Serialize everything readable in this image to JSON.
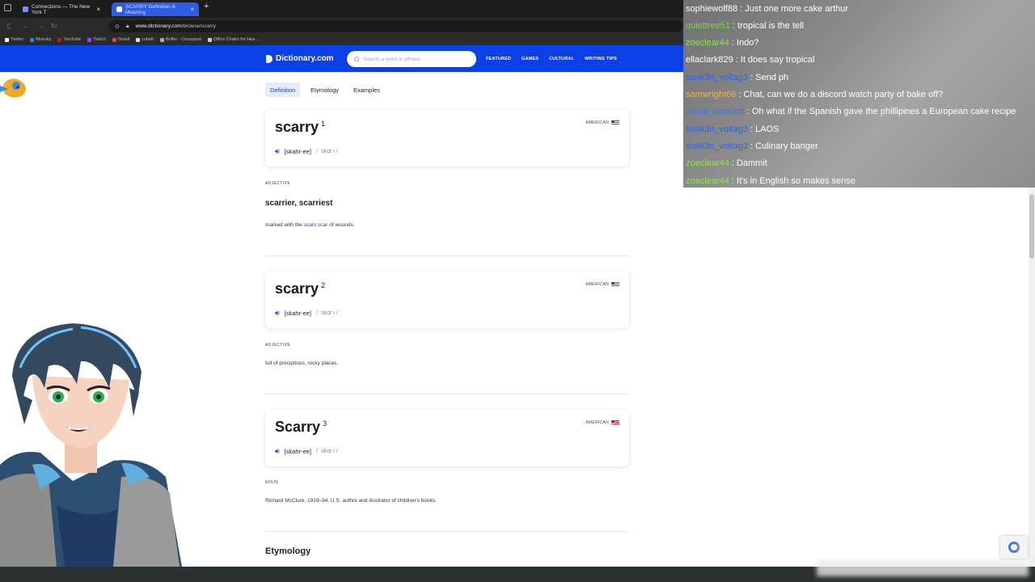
{
  "browser": {
    "tabs": [
      {
        "label": "Connections — The New York T"
      },
      {
        "label": "SCARRY Definition & Meaning"
      }
    ],
    "url_host": "www.dictionary.com",
    "url_path": "/browse/scarry",
    "bookmarks": [
      {
        "label": "Twitter",
        "color": "#ffffff"
      },
      {
        "label": "Bluesky",
        "color": "#1185fe"
      },
      {
        "label": "YouTube",
        "color": "#ff0000"
      },
      {
        "label": "Twitch",
        "color": "#9146ff"
      },
      {
        "label": "Gmail",
        "color": "#ea4335"
      },
      {
        "label": "cobalt",
        "color": "#dddddd"
      },
      {
        "label": "Buffer - Crosspost",
        "color": "#aaaaaa"
      },
      {
        "label": "Office Chairs for Hea...",
        "color": "#cccccc"
      }
    ]
  },
  "site": {
    "logo": "Dictionary.com",
    "search_placeholder": "Search a word or phrase",
    "nav": [
      "FEATURED",
      "GAMES",
      "CULTURAL",
      "WRITING TIPS"
    ],
    "brand_color": "#0b40e6"
  },
  "subtabs": [
    "Definition",
    "Etymology",
    "Examples"
  ],
  "entries": [
    {
      "word": "scarry",
      "number": "1",
      "origin": "AMERICAN",
      "pron": "[skahr-ee]",
      "ipa": "/ ˈskɑr i /",
      "pos": "ADJECTIVE",
      "forms": "scarrier, scarriest",
      "def_pre": "marked with the ",
      "def_link1": "scars",
      "def_mid": " ",
      "def_link2": "scar",
      "def_post": " of wounds."
    },
    {
      "word": "scarry",
      "number": "2",
      "origin": "AMERICAN",
      "pron": "[skahr-ee]",
      "ipa": "/ ˈskɑr i /",
      "pos": "ADJECTIVE",
      "def": "full of precipitous, rocky places."
    },
    {
      "word": "Scarry",
      "number": "3",
      "origin": "AMERICAN",
      "pron": "[skahr-ee]",
      "ipa": "/ ˈskɑr i /",
      "pos": "NOUN",
      "def": "Richard McClure, 1919–94, U.S. author and illustrator of children's books."
    }
  ],
  "etymology_title": "Etymology",
  "chat": [
    {
      "user": "sophiewolf88",
      "msg": "Just one more cake arthur",
      "color": "#ffffff"
    },
    {
      "user": "quiettree51",
      "msg": "tropical is the tell",
      "color": "#6fdc3c"
    },
    {
      "user": "zoeclear44",
      "msg": "Indo?",
      "color": "#8ee44b"
    },
    {
      "user": "ellaclark829",
      "msg": "It does say tropical",
      "color": "#ffffff"
    },
    {
      "user": "sunk3n_voltag3",
      "msg": "Send ph",
      "color": "#2e63e8"
    },
    {
      "user": "samwright66",
      "msg": "Chat, can we do a discord watch party of bake off?",
      "color": "#f4b23c"
    },
    {
      "user": "found_sore3ch",
      "msg": "Oh what if the Spanish gave the phillipines a European cake recipe",
      "color": "#3a78f0"
    },
    {
      "user": "sunk3n_voltag3",
      "msg": "LAOS",
      "color": "#2e63e8"
    },
    {
      "user": "sunk3n_voltag3",
      "msg": "Culinary banger",
      "color": "#2e63e8"
    },
    {
      "user": "zoeclear44",
      "msg": "Dammit",
      "color": "#8ee44b"
    },
    {
      "user": "zoeclear44",
      "msg": "It's in English so makes sense",
      "color": "#8ee44b"
    }
  ],
  "icons": [
    "lock-icon",
    "search-icon",
    "speaker-icon",
    "flag-icon",
    "recaptcha-icon"
  ]
}
